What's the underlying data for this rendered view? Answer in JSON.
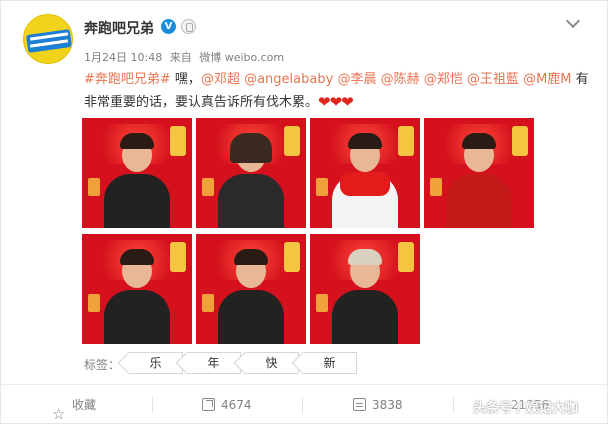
{
  "post": {
    "author": "奔跑吧兄弟",
    "verified_mark": "V",
    "date": "1月24日 10:48",
    "source_prefix": "来自",
    "source": "微博 weibo.com",
    "text_segments": [
      {
        "type": "topic",
        "text": "#奔跑吧兄弟#"
      },
      {
        "type": "plain",
        "text": " 嘿，"
      },
      {
        "type": "mention",
        "text": "@邓超"
      },
      {
        "type": "plain",
        "text": " "
      },
      {
        "type": "mention",
        "text": "@angelababy"
      },
      {
        "type": "plain",
        "text": " "
      },
      {
        "type": "mention",
        "text": "@李晨"
      },
      {
        "type": "plain",
        "text": " "
      },
      {
        "type": "mention",
        "text": "@陈赫"
      },
      {
        "type": "plain",
        "text": " "
      },
      {
        "type": "mention",
        "text": "@郑恺"
      },
      {
        "type": "plain",
        "text": " "
      },
      {
        "type": "mention",
        "text": "@王祖藍"
      },
      {
        "type": "plain",
        "text": " "
      },
      {
        "type": "mention",
        "text": "@M鹿M"
      },
      {
        "type": "plain",
        "text": " 有非常重要的话，要认真告诉所有伐木累。"
      }
    ],
    "hearts": "❤❤❤"
  },
  "photos": [
    {
      "name": "photo-1",
      "style": "dark"
    },
    {
      "name": "photo-2",
      "style": "dress"
    },
    {
      "name": "photo-3",
      "style": "white"
    },
    {
      "name": "photo-4",
      "style": "red"
    },
    {
      "name": "photo-5",
      "style": "dark"
    },
    {
      "name": "photo-6",
      "style": "dark"
    },
    {
      "name": "photo-7",
      "style": "light"
    }
  ],
  "tags": {
    "label": "标签：",
    "items": [
      "乐",
      "年",
      "快",
      "新"
    ]
  },
  "actions": {
    "favorite": "收藏",
    "forward_count": "4674",
    "comment_count": "3838",
    "like_count": "21356"
  },
  "watermark": "头条号 / 娱记大咖",
  "colors": {
    "link": "#eb7350",
    "verified": "#1a8cd8",
    "poster_red": "#d4111c"
  }
}
